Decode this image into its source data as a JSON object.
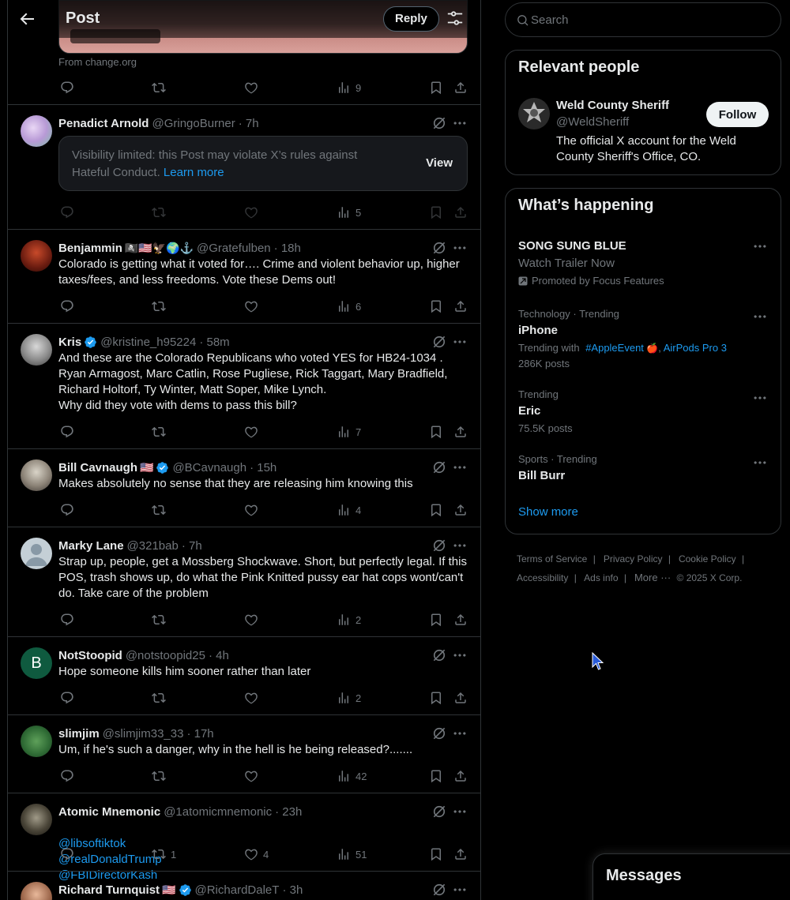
{
  "header": {
    "title": "Post",
    "reply_label": "Reply"
  },
  "link_card": {
    "source": "From change.org",
    "views": "9"
  },
  "posts": [
    {
      "name": "Penadict Arnold",
      "handle": "@GringoBurner",
      "time": "· 7h",
      "limited": {
        "message": "Visibility limited: this Post may violate X’s rules against Hateful Conduct.",
        "learn_more": "Learn more",
        "view": "View"
      },
      "views": "5"
    },
    {
      "name": "Benjammin",
      "emoji": "🏴‍☠️🇺🇸🦅🌍⚓",
      "handle": "@Gratefulben",
      "time": "· 18h",
      "text": "Colorado is getting what it voted for…. Crime and violent behavior up, higher taxes/fees, and less freedoms. Vote these Dems out!",
      "views": "6"
    },
    {
      "name": "Kris",
      "verified": true,
      "handle": "@kristine_h95224",
      "time": "· 58m",
      "text": "And these are the Colorado Republicans who voted YES for HB24-1034 . \nRyan Armagost, Marc Catlin, Rose Pugliese, Rick Taggart, Mary Bradfield, Richard Holtorf, Ty Winter, Matt Soper, Mike Lynch.\nWhy did they vote with dems to pass this bill?",
      "views": "7"
    },
    {
      "name": "Bill Cavnaugh",
      "emoji": "🇺🇸",
      "verified": true,
      "handle": "@BCavnaugh",
      "time": "· 15h",
      "text": "Makes absolutely no sense that they are releasing him knowing this",
      "views": "4"
    },
    {
      "name": "Marky Lane",
      "handle": "@321bab",
      "time": "· 7h",
      "text": "Strap up, people, get a Mossberg Shockwave. Short, but perfectly legal. If this POS, trash shows up, do what the Pink Knitted pussy ear hat cops wont/can't do.  Take care of the problem",
      "views": "2"
    },
    {
      "name": "NotStoopid",
      "handle": "@notstoopid25",
      "time": "· 4h",
      "avatar_letter": "B",
      "text": "Hope someone kills him sooner rather than later",
      "views": "2"
    },
    {
      "name": "slimjim",
      "handle": "@slimjim33_33",
      "time": "· 17h",
      "text": "Um, if he's such a danger, why in the hell is he being released?.......",
      "views": "42"
    },
    {
      "name": "Atomic Mnemonic",
      "handle": "@1atomicmnemonic",
      "time": "· 23h",
      "mentions": [
        "@libsoftiktok",
        "@realDonaldTrump",
        "@FBIDirectorKash"
      ],
      "reposts": "1",
      "likes": "4",
      "views": "51"
    },
    {
      "name": "Richard Turnquist",
      "emoji": "🇺🇸",
      "verified": true,
      "handle": "@RichardDaleT",
      "time": "· 3h"
    }
  ],
  "search": {
    "placeholder": "Search"
  },
  "relevant": {
    "title": "Relevant people",
    "name": "Weld County Sheriff",
    "handle": "@WeldSheriff",
    "bio": "The official X account for the Weld County Sheriff's Office, CO.",
    "follow": "Follow"
  },
  "happening": {
    "title": "What’s happening",
    "items": [
      {
        "name": "SONG SUNG BLUE",
        "sub": "Watch Trailer Now",
        "promo": "Promoted by Focus Features"
      },
      {
        "meta": "Technology · Trending",
        "name": "iPhone",
        "with_label": "Trending with",
        "tag1": "#AppleEvent",
        "tag2": "AirPods Pro 3",
        "count": "286K posts"
      },
      {
        "meta": "Trending",
        "name": "Eric",
        "count": "75.5K posts"
      },
      {
        "meta": "Sports · Trending",
        "name": "Bill Burr"
      }
    ],
    "show_more": "Show more"
  },
  "footer": {
    "terms": "Terms of Service",
    "privacy": "Privacy Policy",
    "cookie": "Cookie Policy",
    "accessibility": "Accessibility",
    "ads": "Ads info",
    "more": "More ···",
    "copyright": "© 2025 X Corp."
  },
  "messages": {
    "title": "Messages"
  },
  "colors": {
    "accent": "#1d9bf0",
    "background": "#000000",
    "border": "#2f3336",
    "muted": "#71767b"
  }
}
